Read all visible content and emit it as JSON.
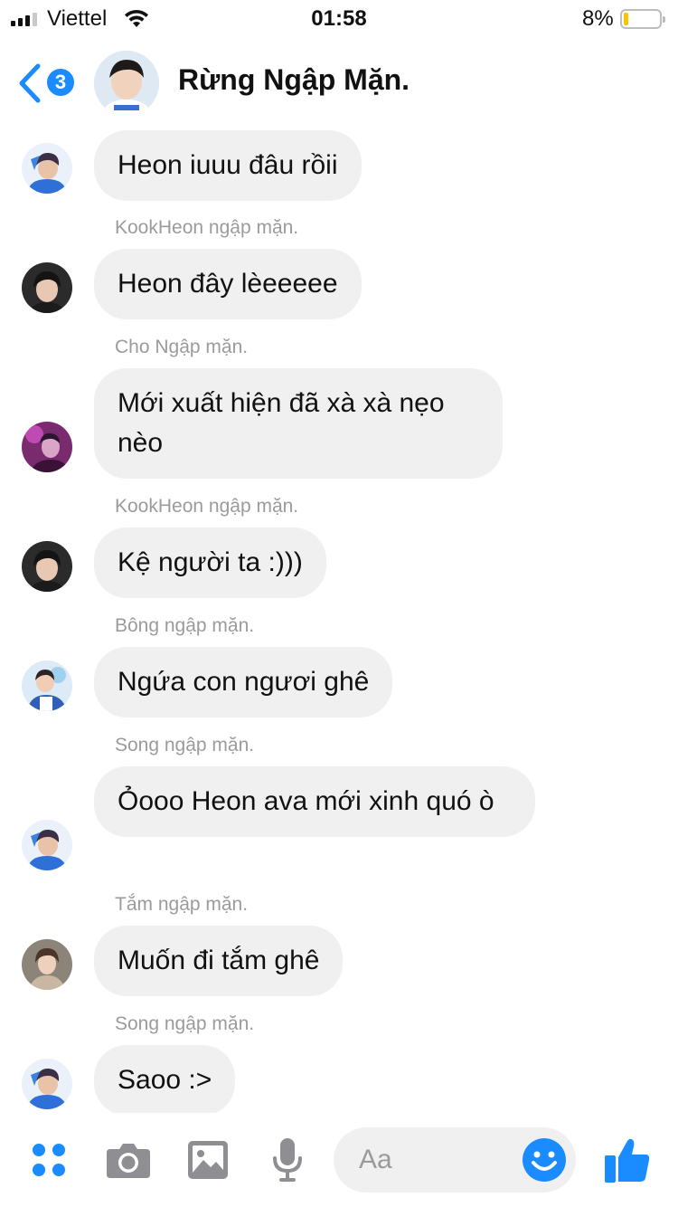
{
  "status_bar": {
    "carrier": "Viettel",
    "time": "01:58",
    "battery_percent": "8%",
    "battery_level": 0.08
  },
  "header": {
    "back_count": "3",
    "title": "Rừng Ngập Mặn."
  },
  "messages": [
    {
      "sender": "",
      "text": "Heon iuuu đâu rồii",
      "avatar": "avatar-1"
    },
    {
      "sender": "KookHeon ngập mặn.",
      "text": "Heon đây lèeeeee",
      "avatar": "avatar-2"
    },
    {
      "sender": "Cho Ngập mặn.",
      "text": "Mới xuất hiện đã xà xà nẹo nèo",
      "avatar": "avatar-3"
    },
    {
      "sender": "KookHeon ngập mặn.",
      "text": "Kệ người ta :)))",
      "avatar": "avatar-2"
    },
    {
      "sender": "Bông ngập mặn.",
      "text": "Ngứa con ngươi ghê",
      "avatar": "avatar-4"
    },
    {
      "sender": "Song ngập mặn.",
      "text": "Ỏooo Heon ava mới xinh quó ò",
      "avatar": "avatar-1"
    },
    {
      "sender": "Tắm ngập mặn.",
      "text": "Muốn đi tắm ghê",
      "avatar": "avatar-5"
    },
    {
      "sender": "Song ngập mặn.",
      "text": "Saoo :>",
      "avatar": "avatar-1"
    }
  ],
  "composer": {
    "placeholder": "Aa"
  },
  "toolbar": {
    "icons": [
      "apps-icon",
      "camera-icon",
      "gallery-icon",
      "microphone-icon",
      "emoji-icon",
      "thumbs-up-icon"
    ]
  },
  "colors": {
    "accent": "#1a8cff",
    "bubble": "#f0f0f0",
    "sender_label": "#9b9b9b",
    "toolbar_gray": "#8e8e93",
    "battery_fill": "#f7c600"
  }
}
